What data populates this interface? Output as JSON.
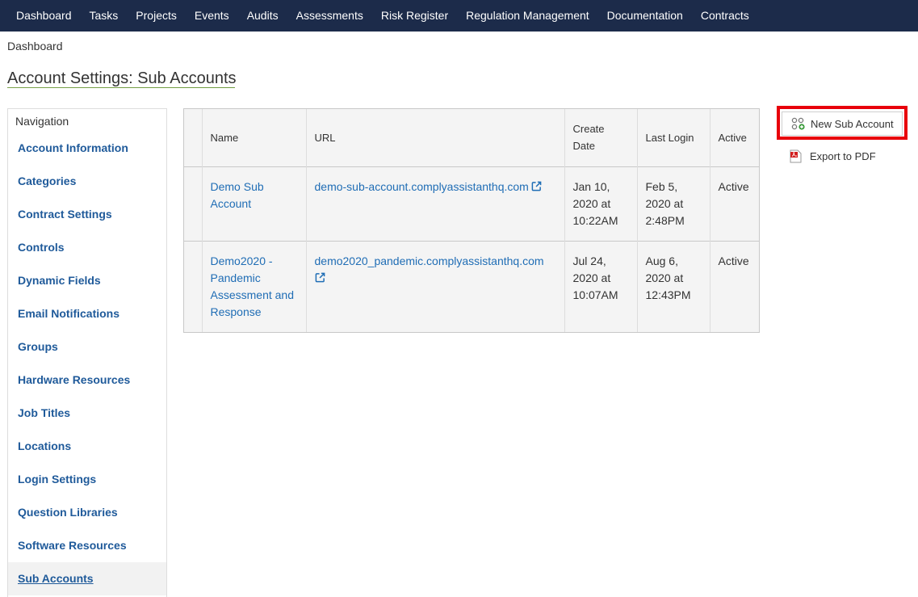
{
  "topnav": {
    "items": [
      "Dashboard",
      "Tasks",
      "Projects",
      "Events",
      "Audits",
      "Assessments",
      "Risk Register",
      "Regulation Management",
      "Documentation",
      "Contracts"
    ]
  },
  "breadcrumb": "Dashboard",
  "page_title": "Account Settings: Sub Accounts",
  "sidenav": {
    "heading": "Navigation",
    "items": [
      "Account Information",
      "Categories",
      "Contract Settings",
      "Controls",
      "Dynamic Fields",
      "Email Notifications",
      "Groups",
      "Hardware Resources",
      "Job Titles",
      "Locations",
      "Login Settings",
      "Question Libraries",
      "Software Resources",
      "Sub Accounts"
    ],
    "active": "Sub Accounts"
  },
  "table": {
    "headers": {
      "name": "Name",
      "url": "URL",
      "create_date": "Create Date",
      "last_login": "Last Login",
      "active": "Active"
    },
    "rows": [
      {
        "name": "Demo Sub Account",
        "url": "demo-sub-account.complyassistanthq.com",
        "create_date": "Jan 10, 2020 at 10:22AM",
        "last_login": "Feb 5, 2020 at 2:48PM",
        "active": "Active"
      },
      {
        "name": "Demo2020 - Pandemic Assessment and Response",
        "url": "demo2020_pandemic.complyassistanthq.com",
        "create_date": "Jul 24, 2020 at 10:07AM",
        "last_login": "Aug 6, 2020 at 12:43PM",
        "active": "Active"
      }
    ]
  },
  "actions": {
    "new_sub_account": "New Sub Account",
    "export_pdf": "Export to PDF"
  },
  "icons": {
    "new_sub_account": "sub-account-icon",
    "export_pdf": "pdf-icon",
    "url_link": "external-link-icon"
  },
  "colors": {
    "topnav_bg": "#1c2b4a",
    "link": "#1f6db5",
    "highlight_box": "#e8000b"
  }
}
